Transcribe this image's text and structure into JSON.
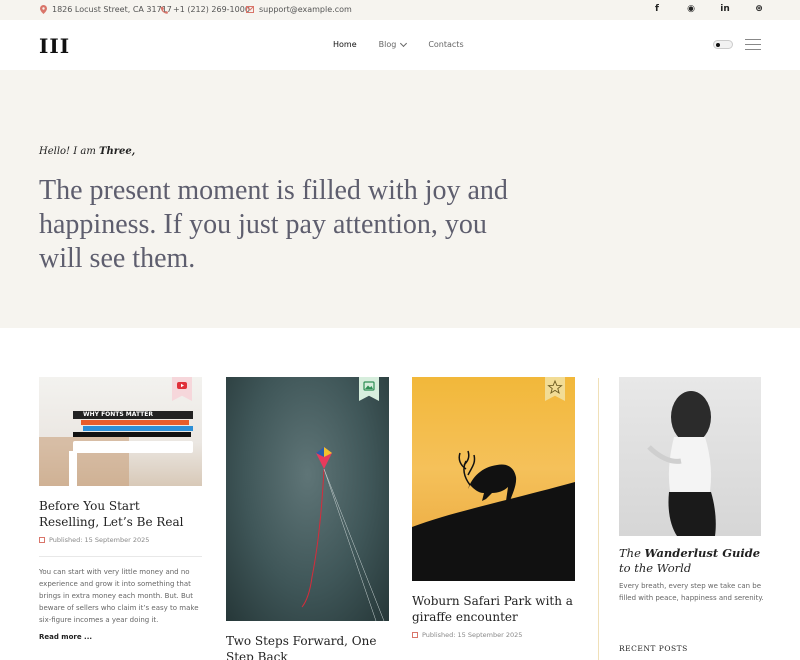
{
  "topbar": {
    "address": "1826 Locust Street, CA 31717",
    "phone": "+1 (212) 269-1000",
    "email": "support@example.com",
    "socials": [
      {
        "icon": "facebook-icon",
        "glyph": "f"
      },
      {
        "icon": "github-icon",
        "glyph": "◉"
      },
      {
        "icon": "linkedin-icon",
        "glyph": "in"
      },
      {
        "icon": "dribbble-icon",
        "glyph": "⊛"
      }
    ]
  },
  "header": {
    "logo": "III",
    "nav": [
      {
        "label": "Home"
      },
      {
        "label": "Blog"
      },
      {
        "label": "Contacts"
      }
    ]
  },
  "hero": {
    "greeting_prefix": "Hello! I am ",
    "greeting_name": "Three,",
    "headline": "The present moment is filled with joy and happiness. If you just pay attention, you will see them."
  },
  "posts": [
    {
      "title": "Before You Start Reselling, Let’s Be Real",
      "date": "Published: 15 September 2025",
      "excerpt": "You can start with very little money and no experience and grow it into something that brings in extra money each month. But. But beware of sellers who claim it’s easy to make six-figure incomes a year doing it.",
      "read_more": "Read more ...",
      "book_text": "WHY FONTS MATTER"
    },
    {
      "title": "Two Steps Forward, One Step Back"
    },
    {
      "title": "Woburn Safari Park with a giraffe encounter",
      "date": "Published: 15 September 2025"
    }
  ],
  "sidebar": {
    "title_pre": "The ",
    "title_bold": "Wanderlust Guide",
    "title_post": " to the World",
    "text": "Every breath, every step we take can be filled with peace, happiness and serenity.",
    "recent_heading": "RECENT POSTS"
  },
  "colors": {
    "accent": "#d9756a",
    "hero_bg": "#f6f4ef",
    "ribbon_pink": "#f6d7db",
    "ribbon_green": "#d7eedd",
    "ribbon_gold": "#f2dc95"
  }
}
